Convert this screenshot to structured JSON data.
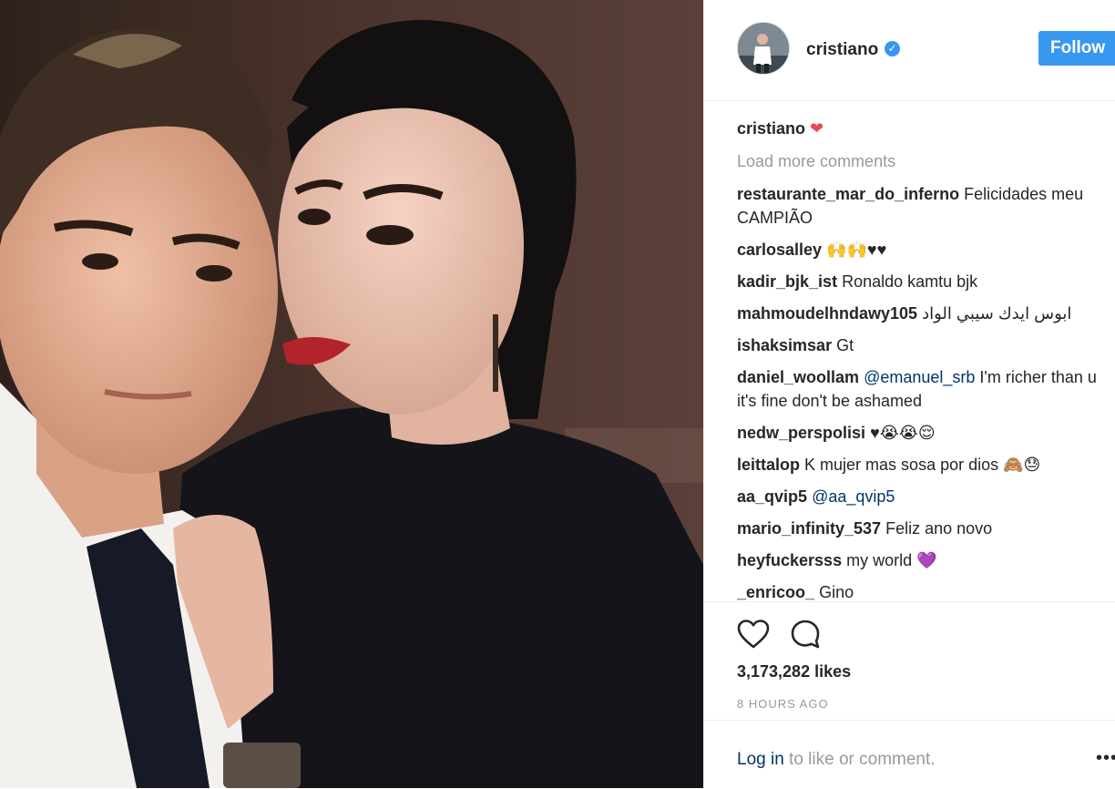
{
  "post": {
    "username": "cristiano",
    "follow_label": "Follow",
    "caption": {
      "author": "cristiano",
      "emoji": "❤"
    },
    "load_more": "Load more comments",
    "comments": [
      {
        "author": "restaurante_mar_do_inferno",
        "text": "Felicidades meu CAMPIÃO"
      },
      {
        "author": "carlosalley",
        "text": "🙌🙌♥♥"
      },
      {
        "author": "kadir_bjk_ist",
        "text": "Ronaldo kamtu bjk"
      },
      {
        "author": "mahmoudelhndawy105",
        "text": "ابوس ايدك سيبي الواد"
      },
      {
        "author": "ishaksimsar",
        "text": "Gt"
      },
      {
        "author": "daniel_woollam",
        "mention": "@emanuel_srb",
        "text": "I'm richer than u it's fine don't be ashamed"
      },
      {
        "author": "nedw_perspolisi",
        "text": "♥😭😭😌"
      },
      {
        "author": "leittalop",
        "text": "K mujer mas sosa por dios 🙈😓"
      },
      {
        "author": "aa_qvip5",
        "mention": "@aa_qvip5",
        "text": ""
      },
      {
        "author": "mario_infinity_537",
        "text": "Feliz ano novo"
      },
      {
        "author": "heyfuckersss",
        "text": "my world",
        "emoji": "💜"
      },
      {
        "author": "_enricoo_",
        "text": "Gino"
      }
    ],
    "likes": "3,173,282 likes",
    "time": "8 HOURS AGO",
    "login_link": "Log in",
    "login_rest": " to like or comment.",
    "more": "•••"
  },
  "icons": {
    "verified": "verified-badge-icon",
    "like": "heart-outline-icon",
    "comment": "speech-bubble-icon",
    "more": "ellipsis-icon"
  },
  "colors": {
    "accent": "#3897f0",
    "muted_text": "#999999",
    "link": "#003569",
    "heart": "#ed4956"
  }
}
